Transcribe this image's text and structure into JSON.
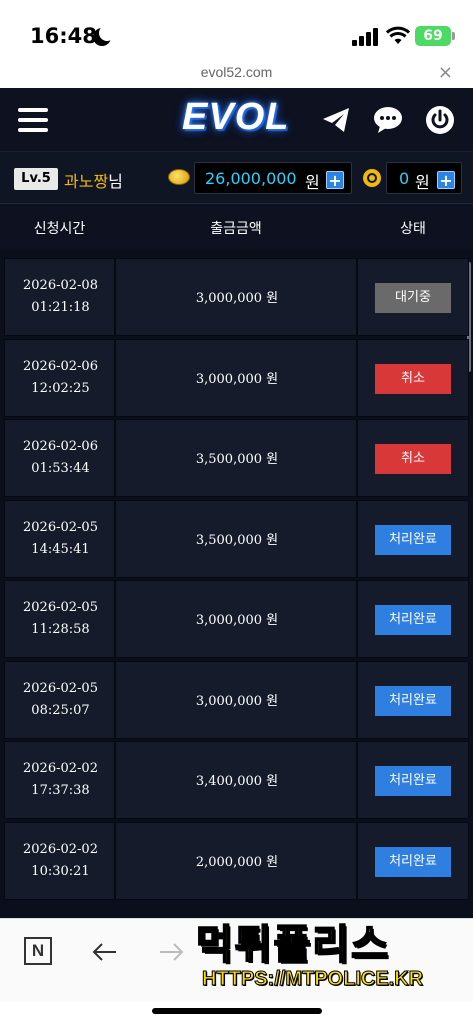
{
  "status_bar": {
    "time": "16:48",
    "battery": "69"
  },
  "browser": {
    "url": "evol52.com",
    "close_icon": "×"
  },
  "header": {
    "logo": "EVOL"
  },
  "user": {
    "level": "Lv.5",
    "name": "과노짱",
    "name_suffix": "님",
    "balance_value": "26,000,000",
    "balance_unit": "원",
    "point_value": "0",
    "point_unit": "원",
    "plus_label": "+"
  },
  "table": {
    "headers": [
      "신청시간",
      "출금금액",
      "상태"
    ],
    "rows": [
      {
        "date": "2026-02-08",
        "time": "01:21:18",
        "amount": "3,000,000 원",
        "status": "대기중",
        "status_type": "wait"
      },
      {
        "date": "2026-02-06",
        "time": "12:02:25",
        "amount": "3,000,000 원",
        "status": "취소",
        "status_type": "cancel"
      },
      {
        "date": "2026-02-06",
        "time": "01:53:44",
        "amount": "3,500,000 원",
        "status": "취소",
        "status_type": "cancel"
      },
      {
        "date": "2026-02-05",
        "time": "14:45:41",
        "amount": "3,500,000 원",
        "status": "처리완료",
        "status_type": "done"
      },
      {
        "date": "2026-02-05",
        "time": "11:28:58",
        "amount": "3,000,000 원",
        "status": "처리완료",
        "status_type": "done"
      },
      {
        "date": "2026-02-05",
        "time": "08:25:07",
        "amount": "3,000,000 원",
        "status": "처리완료",
        "status_type": "done"
      },
      {
        "date": "2026-02-02",
        "time": "17:37:38",
        "amount": "3,400,000 원",
        "status": "처리완료",
        "status_type": "done"
      },
      {
        "date": "2026-02-02",
        "time": "10:30:21",
        "amount": "2,000,000 원",
        "status": "처리완료",
        "status_type": "done"
      }
    ]
  },
  "toolbar": {
    "n_label": "N"
  },
  "watermark": {
    "main": "먹튀폴리스",
    "sub": "HTTPS://MTPOLICE.KR"
  },
  "icons": {
    "menu": "hamburger-icon",
    "telegram": "telegram-icon",
    "chat": "chat-icon",
    "power": "power-icon",
    "coin": "coin-icon",
    "chip": "chip-icon",
    "back": "arrow-left-icon",
    "forward": "arrow-right-icon"
  },
  "colors": {
    "header_bg": "#0d1120",
    "balance": "#2ad1ff",
    "username": "#f0b90b",
    "wait": "#6a6a6a",
    "cancel": "#d93838",
    "done": "#2f7fe0"
  }
}
